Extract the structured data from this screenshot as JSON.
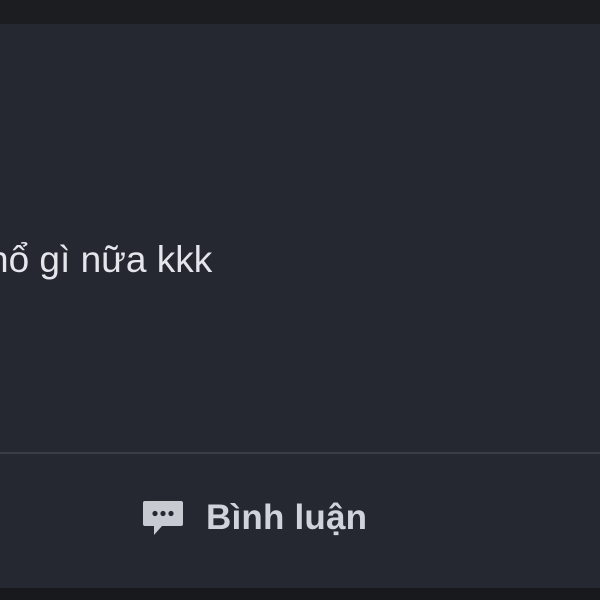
{
  "post": {
    "text": "hổ gì nữa kkk"
  },
  "actions": {
    "comment_label": "Bình luận",
    "comment_icon": "comment-icon"
  },
  "colors": {
    "background": "#252830",
    "text": "#e4e6eb",
    "icon": "#c7cad1"
  }
}
